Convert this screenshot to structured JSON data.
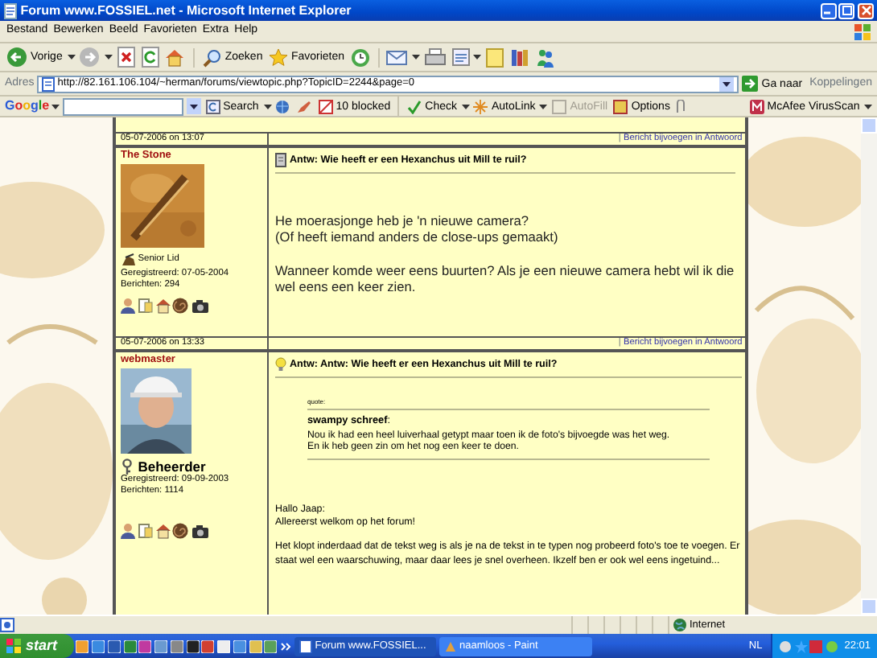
{
  "window": {
    "title": "Forum www.FOSSIEL.net - Microsoft Internet Explorer"
  },
  "menu": [
    "Bestand",
    "Bewerken",
    "Beeld",
    "Favorieten",
    "Extra",
    "Help"
  ],
  "toolbar": {
    "back": "Vorige",
    "search": "Zoeken",
    "favorites": "Favorieten"
  },
  "address_bar": {
    "label": "Adres",
    "url": "http://82.161.106.104/~herman/forums/viewtopic.php?TopicID=2244&page=0",
    "go": "Ga naar",
    "links": "Koppelingen"
  },
  "google_toolbar": {
    "logo": "Google",
    "search": "Search",
    "blocked": "10 blocked",
    "check": "Check",
    "autolink": "AutoLink",
    "autofill": {
      "label": "AutoFill",
      "disabled": true
    },
    "options": "Options",
    "virusscan": "McAfee VirusScan"
  },
  "posts": [
    {
      "date": "05-07-2006 on 13:07",
      "separator": "|",
      "reply_link": "Bericht bijvoegen in Antwoord",
      "author": "The Stone",
      "avatar": {
        "kind": "picture"
      },
      "rank": {
        "kind": "member",
        "label": "Senior Lid"
      },
      "registered": "Geregistreerd: 07-05-2004",
      "messages": "Berichten: 294",
      "title": {
        "kind": "page",
        "text": "Antw: Wie heeft er een Hexanchus uit Mill te ruil?"
      },
      "body": {
        "kind": "large"
      },
      "blocks": [
        {
          "kind": "text",
          "lines": [
            "He moerasjonge heb je 'n nieuwe camera?",
            "(Of heeft iemand anders de close-ups gemaakt)"
          ]
        },
        {
          "kind": "text",
          "lines": [
            "Wanneer komde weer eens buurten? Als je een nieuwe camera hebt wil ik die wel eens een keer zien."
          ]
        }
      ]
    },
    {
      "date": "05-07-2006 on 13:33",
      "separator": "|",
      "reply_link": "Bericht bijvoegen in Antwoord",
      "author": "webmaster",
      "avatar": {
        "kind": "figure"
      },
      "rank": {
        "kind": "admin",
        "label": "Beheerder"
      },
      "registered": "Geregistreerd: 09-09-2003",
      "messages": "Berichten: 1114",
      "title": {
        "kind": "bulb",
        "text": "Antw: Antw: Wie heeft er een Hexanchus uit Mill te ruil?"
      },
      "body": {
        "kind": "small"
      },
      "blocks": [
        {
          "kind": "quote",
          "label": "quote:",
          "author": "**swampy schreef**:",
          "lines": [
            "Nou ik had een heel luiverhaal getypt maar toen ik de foto's bijvoegde was het weg.",
            "En ik heb geen zin om het nog een keer te doen."
          ]
        },
        {
          "kind": "text",
          "lines": [
            "Hallo Jaap:",
            "Allereerst welkom op het forum!"
          ]
        },
        {
          "kind": "text",
          "lines": [
            "Het klopt inderdaad dat de tekst weg is als je na de tekst in te typen nog probeerd foto's toe te voegen. Er staat wel een waarschuwing, maar daar lees je snel overheen. Ikzelf ben er ook wel eens ingetuind..."
          ]
        }
      ]
    }
  ],
  "status_bar": {
    "zone": "Internet"
  },
  "taskbar": {
    "start": "start",
    "tasks": [
      {
        "label": "Forum www.FOSSIEL...",
        "selected": true
      },
      {
        "label": "naamloos - Paint",
        "selected": false
      }
    ],
    "language": "NL",
    "clock": "22:01"
  }
}
